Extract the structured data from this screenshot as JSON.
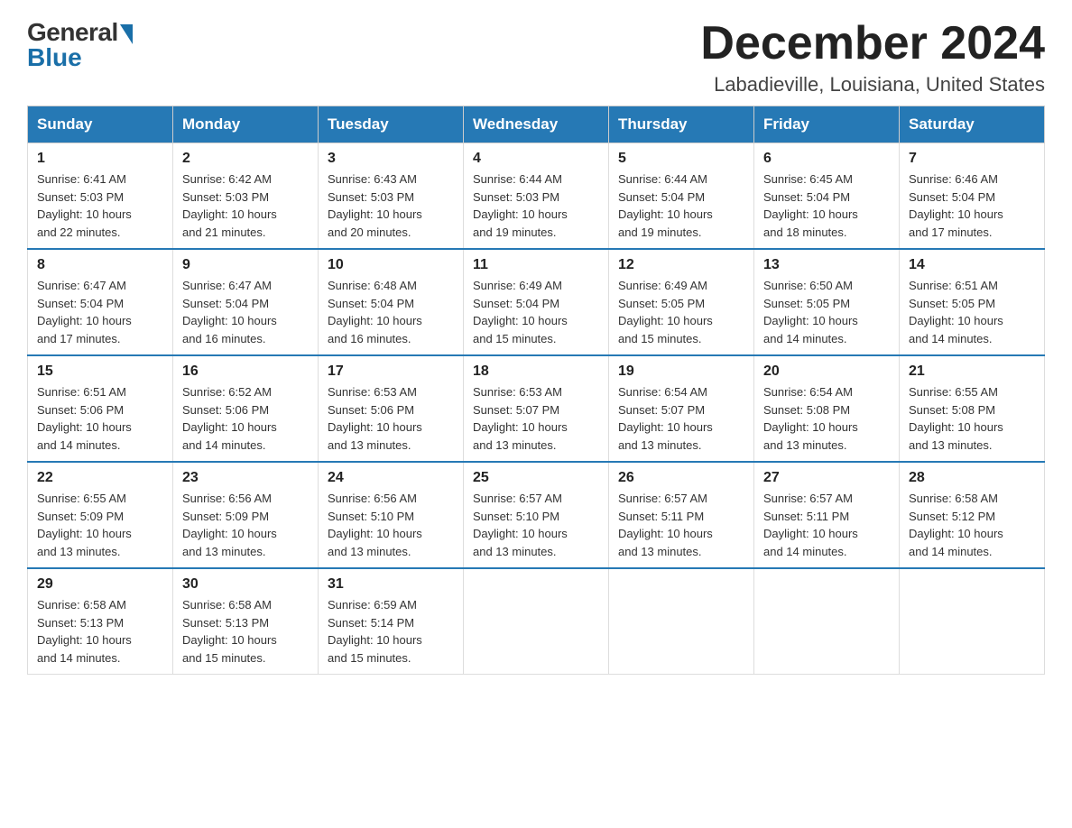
{
  "header": {
    "logo_general": "General",
    "logo_blue": "Blue",
    "title": "December 2024",
    "location": "Labadieville, Louisiana, United States"
  },
  "weekdays": [
    "Sunday",
    "Monday",
    "Tuesday",
    "Wednesday",
    "Thursday",
    "Friday",
    "Saturday"
  ],
  "weeks": [
    [
      {
        "day": "1",
        "sunrise": "6:41 AM",
        "sunset": "5:03 PM",
        "daylight": "10 hours and 22 minutes."
      },
      {
        "day": "2",
        "sunrise": "6:42 AM",
        "sunset": "5:03 PM",
        "daylight": "10 hours and 21 minutes."
      },
      {
        "day": "3",
        "sunrise": "6:43 AM",
        "sunset": "5:03 PM",
        "daylight": "10 hours and 20 minutes."
      },
      {
        "day": "4",
        "sunrise": "6:44 AM",
        "sunset": "5:03 PM",
        "daylight": "10 hours and 19 minutes."
      },
      {
        "day": "5",
        "sunrise": "6:44 AM",
        "sunset": "5:04 PM",
        "daylight": "10 hours and 19 minutes."
      },
      {
        "day": "6",
        "sunrise": "6:45 AM",
        "sunset": "5:04 PM",
        "daylight": "10 hours and 18 minutes."
      },
      {
        "day": "7",
        "sunrise": "6:46 AM",
        "sunset": "5:04 PM",
        "daylight": "10 hours and 17 minutes."
      }
    ],
    [
      {
        "day": "8",
        "sunrise": "6:47 AM",
        "sunset": "5:04 PM",
        "daylight": "10 hours and 17 minutes."
      },
      {
        "day": "9",
        "sunrise": "6:47 AM",
        "sunset": "5:04 PM",
        "daylight": "10 hours and 16 minutes."
      },
      {
        "day": "10",
        "sunrise": "6:48 AM",
        "sunset": "5:04 PM",
        "daylight": "10 hours and 16 minutes."
      },
      {
        "day": "11",
        "sunrise": "6:49 AM",
        "sunset": "5:04 PM",
        "daylight": "10 hours and 15 minutes."
      },
      {
        "day": "12",
        "sunrise": "6:49 AM",
        "sunset": "5:05 PM",
        "daylight": "10 hours and 15 minutes."
      },
      {
        "day": "13",
        "sunrise": "6:50 AM",
        "sunset": "5:05 PM",
        "daylight": "10 hours and 14 minutes."
      },
      {
        "day": "14",
        "sunrise": "6:51 AM",
        "sunset": "5:05 PM",
        "daylight": "10 hours and 14 minutes."
      }
    ],
    [
      {
        "day": "15",
        "sunrise": "6:51 AM",
        "sunset": "5:06 PM",
        "daylight": "10 hours and 14 minutes."
      },
      {
        "day": "16",
        "sunrise": "6:52 AM",
        "sunset": "5:06 PM",
        "daylight": "10 hours and 14 minutes."
      },
      {
        "day": "17",
        "sunrise": "6:53 AM",
        "sunset": "5:06 PM",
        "daylight": "10 hours and 13 minutes."
      },
      {
        "day": "18",
        "sunrise": "6:53 AM",
        "sunset": "5:07 PM",
        "daylight": "10 hours and 13 minutes."
      },
      {
        "day": "19",
        "sunrise": "6:54 AM",
        "sunset": "5:07 PM",
        "daylight": "10 hours and 13 minutes."
      },
      {
        "day": "20",
        "sunrise": "6:54 AM",
        "sunset": "5:08 PM",
        "daylight": "10 hours and 13 minutes."
      },
      {
        "day": "21",
        "sunrise": "6:55 AM",
        "sunset": "5:08 PM",
        "daylight": "10 hours and 13 minutes."
      }
    ],
    [
      {
        "day": "22",
        "sunrise": "6:55 AM",
        "sunset": "5:09 PM",
        "daylight": "10 hours and 13 minutes."
      },
      {
        "day": "23",
        "sunrise": "6:56 AM",
        "sunset": "5:09 PM",
        "daylight": "10 hours and 13 minutes."
      },
      {
        "day": "24",
        "sunrise": "6:56 AM",
        "sunset": "5:10 PM",
        "daylight": "10 hours and 13 minutes."
      },
      {
        "day": "25",
        "sunrise": "6:57 AM",
        "sunset": "5:10 PM",
        "daylight": "10 hours and 13 minutes."
      },
      {
        "day": "26",
        "sunrise": "6:57 AM",
        "sunset": "5:11 PM",
        "daylight": "10 hours and 13 minutes."
      },
      {
        "day": "27",
        "sunrise": "6:57 AM",
        "sunset": "5:11 PM",
        "daylight": "10 hours and 14 minutes."
      },
      {
        "day": "28",
        "sunrise": "6:58 AM",
        "sunset": "5:12 PM",
        "daylight": "10 hours and 14 minutes."
      }
    ],
    [
      {
        "day": "29",
        "sunrise": "6:58 AM",
        "sunset": "5:13 PM",
        "daylight": "10 hours and 14 minutes."
      },
      {
        "day": "30",
        "sunrise": "6:58 AM",
        "sunset": "5:13 PM",
        "daylight": "10 hours and 15 minutes."
      },
      {
        "day": "31",
        "sunrise": "6:59 AM",
        "sunset": "5:14 PM",
        "daylight": "10 hours and 15 minutes."
      },
      null,
      null,
      null,
      null
    ]
  ],
  "labels": {
    "sunrise": "Sunrise:",
    "sunset": "Sunset:",
    "daylight": "Daylight:"
  }
}
